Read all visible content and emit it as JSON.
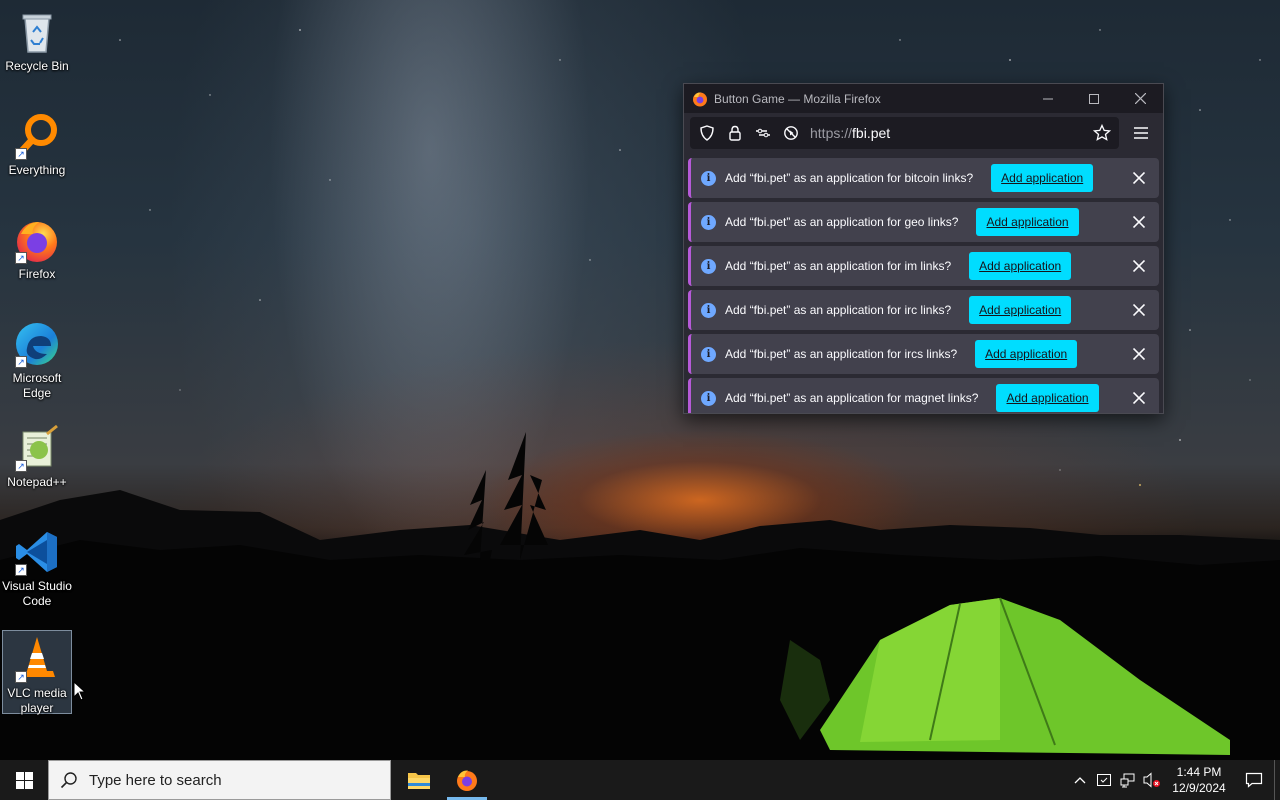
{
  "desktop": {
    "icons": [
      {
        "label": "Recycle Bin",
        "icon": "recycle-bin-icon"
      },
      {
        "label": "Everything",
        "icon": "everything-search-icon"
      },
      {
        "label": "Firefox",
        "icon": "firefox-icon"
      },
      {
        "label": "Microsoft Edge",
        "icon": "edge-icon"
      },
      {
        "label": "Notepad++",
        "icon": "notepad-plus-plus-icon"
      },
      {
        "label": "Visual Studio Code",
        "icon": "vscode-icon"
      },
      {
        "label": "VLC media player",
        "icon": "vlc-icon"
      }
    ],
    "selected_icon": "VLC media player"
  },
  "firefox": {
    "title": "Button Game — Mozilla Firefox",
    "url_scheme": "https://",
    "url_host": "fbi.pet",
    "notifications": [
      {
        "message": "Add “fbi.pet” as an application for bitcoin links?",
        "button": "Add application"
      },
      {
        "message": "Add “fbi.pet” as an application for geo links?",
        "button": "Add application"
      },
      {
        "message": "Add “fbi.pet” as an application for im links?",
        "button": "Add application"
      },
      {
        "message": "Add “fbi.pet” as an application for irc links?",
        "button": "Add application"
      },
      {
        "message": "Add “fbi.pet” as an application for ircs links?",
        "button": "Add application"
      },
      {
        "message": "Add “fbi.pet” as an application for magnet links?",
        "button": "Add application"
      }
    ]
  },
  "taskbar": {
    "search_placeholder": "Type here to search",
    "time": "1:44 PM",
    "date": "12/9/2024"
  },
  "colors": {
    "accent_button": "#00ddff",
    "notification_bg": "#42414d",
    "window_bg": "#2b2a33",
    "taskbar_bg": "#1a1a1a"
  }
}
